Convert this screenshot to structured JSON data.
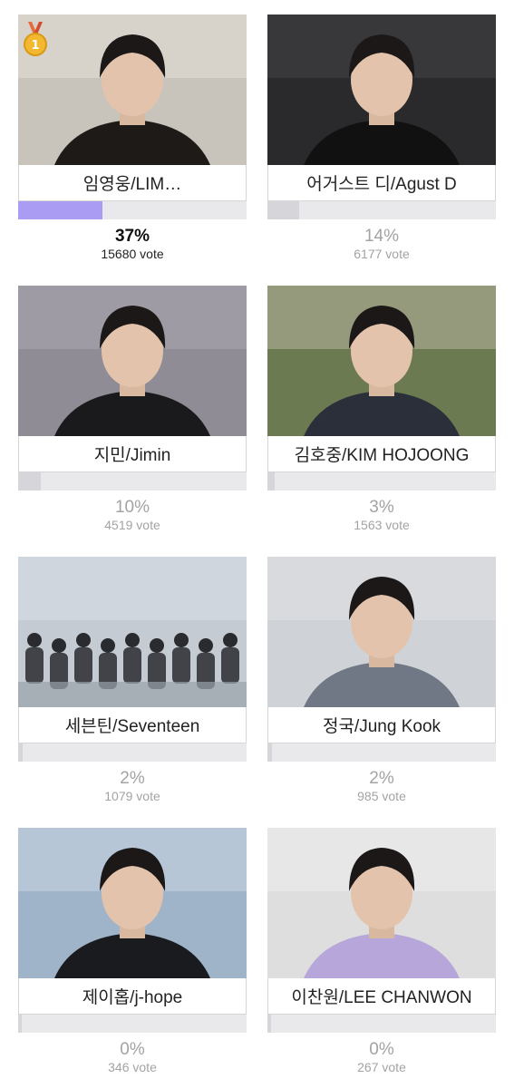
{
  "candidates": [
    {
      "name": "임영웅/LIM…",
      "percent": "37%",
      "votes": "15680 vote",
      "share": 0.37,
      "rank": "1",
      "palette": [
        "#c8c3bb",
        "#e9e6e1",
        "#1d1a18"
      ]
    },
    {
      "name": "어거스트 디/Agust D",
      "percent": "14%",
      "votes": "6177 vote",
      "share": 0.14,
      "palette": [
        "#2a2a2c",
        "#4a4a4d",
        "#111112"
      ]
    },
    {
      "name": "지민/Jimin",
      "percent": "10%",
      "votes": "4519 vote",
      "share": 0.1,
      "palette": [
        "#8f8c95",
        "#b2aeb6",
        "#1a1a1d"
      ]
    },
    {
      "name": "김호중/KIM HOJOONG",
      "percent": "3%",
      "votes": "1563 vote",
      "share": 0.03,
      "palette": [
        "#6c7a52",
        "#c9c2b0",
        "#2b2f3a"
      ]
    },
    {
      "name": "세븐틴/Seventeen",
      "percent": "2%",
      "votes": "1079 vote",
      "share": 0.02,
      "palette": [
        "#c4cbd3",
        "#e0e4e8",
        "#2a2b2f"
      ]
    },
    {
      "name": "정국/Jung Kook",
      "percent": "2%",
      "votes": "985 vote",
      "share": 0.02,
      "palette": [
        "#cfd2d6",
        "#e4e5e7",
        "#6f7884"
      ]
    },
    {
      "name": "제이홉/j-hope",
      "percent": "0%",
      "votes": "346 vote",
      "share": 0.005,
      "palette": [
        "#9fb3c9",
        "#d3dde8",
        "#1a1b1f"
      ]
    },
    {
      "name": "이찬원/LEE CHANWON",
      "percent": "0%",
      "votes": "267 vote",
      "share": 0.004,
      "palette": [
        "#dedede",
        "#f2f2f2",
        "#b7a6d9"
      ]
    }
  ],
  "colors": {
    "leader_bar": "#a99cf2",
    "other_bar": "#d6d6da",
    "track": "#e9e9ec",
    "medal_gold": "#f2b830",
    "medal_ribbon": "#e86a3a"
  },
  "icons": {
    "medal": "medal-icon"
  }
}
